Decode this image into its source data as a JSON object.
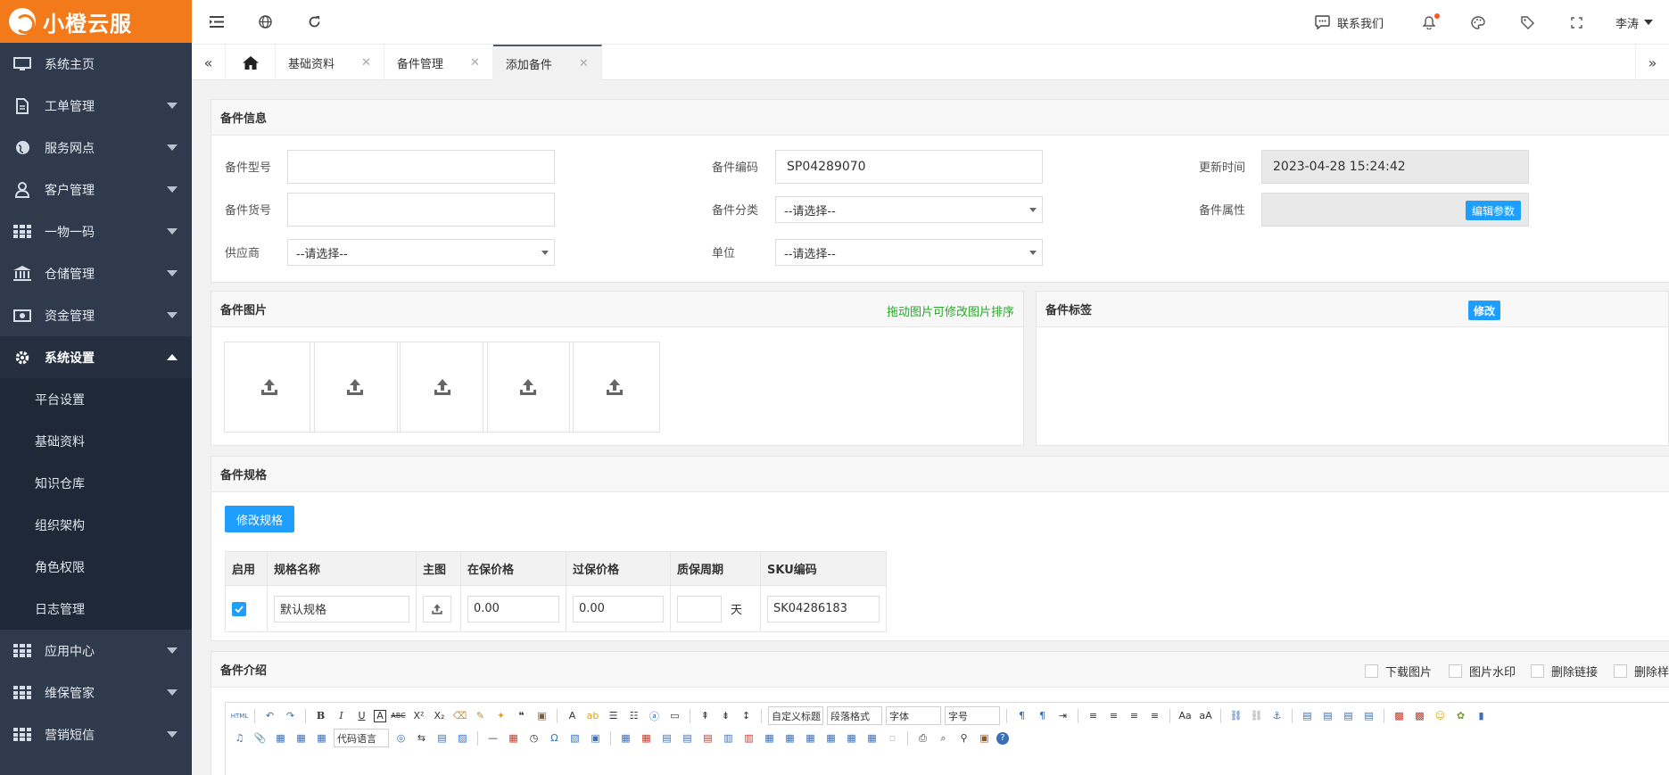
{
  "brand": {
    "name": "小橙云服",
    "color": "#f27a1a"
  },
  "sidebar": {
    "items": [
      {
        "label": "系统主页",
        "icon": "monitor-icon"
      },
      {
        "label": "工单管理",
        "icon": "document-icon"
      },
      {
        "label": "服务网点",
        "icon": "globe-icon"
      },
      {
        "label": "客户管理",
        "icon": "user-icon"
      },
      {
        "label": "一物一码",
        "icon": "grid-icon"
      },
      {
        "label": "仓储管理",
        "icon": "bank-icon"
      },
      {
        "label": "资金管理",
        "icon": "money-icon"
      },
      {
        "label": "系统设置",
        "icon": "gear-icon"
      }
    ],
    "subitems": [
      "平台设置",
      "基础资料",
      "知识仓库",
      "组织架构",
      "角色权限",
      "日志管理"
    ],
    "bottom_items": [
      {
        "label": "应用中心",
        "icon": "grid-icon"
      },
      {
        "label": "维保管家",
        "icon": "grid-icon"
      },
      {
        "label": "营销短信",
        "icon": "grid-icon"
      }
    ]
  },
  "header": {
    "contact_label": "联系我们",
    "user_name": "李涛"
  },
  "tabs": [
    {
      "label": "基础资料"
    },
    {
      "label": "备件管理"
    },
    {
      "label": "添加备件"
    }
  ],
  "info": {
    "title": "备件信息",
    "model_label": "备件型号",
    "model_value": "",
    "code_label": "备件编码",
    "code_value": "SP04289070",
    "update_label": "更新时间",
    "update_value": "2023-04-28 15:24:42",
    "sku_label": "备件货号",
    "sku_value": "",
    "category_label": "备件分类",
    "category_value": "--请选择--",
    "attr_label": "备件属性",
    "attr_button": "编辑参数",
    "supplier_label": "供应商",
    "supplier_value": "--请选择--",
    "unit_label": "单位",
    "unit_value": "--请选择--"
  },
  "images": {
    "title": "备件图片",
    "hint": "拖动图片可修改图片排序",
    "slots": 5
  },
  "tags": {
    "title": "备件标签",
    "edit_button": "修改"
  },
  "spec": {
    "title": "备件规格",
    "edit_button": "修改规格",
    "columns": [
      "启用",
      "规格名称",
      "主图",
      "在保价格",
      "过保价格",
      "质保周期",
      "SKU编码"
    ],
    "row": {
      "enabled": true,
      "name": "默认规格",
      "in_warranty_price": "0.00",
      "out_warranty_price": "0.00",
      "warranty_period": "",
      "period_unit": "天",
      "sku_code": "SK04286183"
    }
  },
  "intro": {
    "title": "备件介绍",
    "options": [
      "下载图片",
      "图片水印",
      "删除链接",
      "删除样式"
    ],
    "editor": {
      "custom_title": "自定义标题",
      "paragraph_format": "段落格式",
      "font_family": "字体",
      "font_size": "字号",
      "code_language": "代码语言",
      "toolbar_row1": [
        "B",
        "I",
        "U",
        "A",
        "ABC",
        "X²",
        "X₂",
        "❝",
        "A"
      ],
      "html_label": "HTML"
    }
  },
  "colors": {
    "accent": "#1e9fff",
    "sidebar_bg": "#2f3a4c",
    "hint_green": "#2aa52a"
  }
}
